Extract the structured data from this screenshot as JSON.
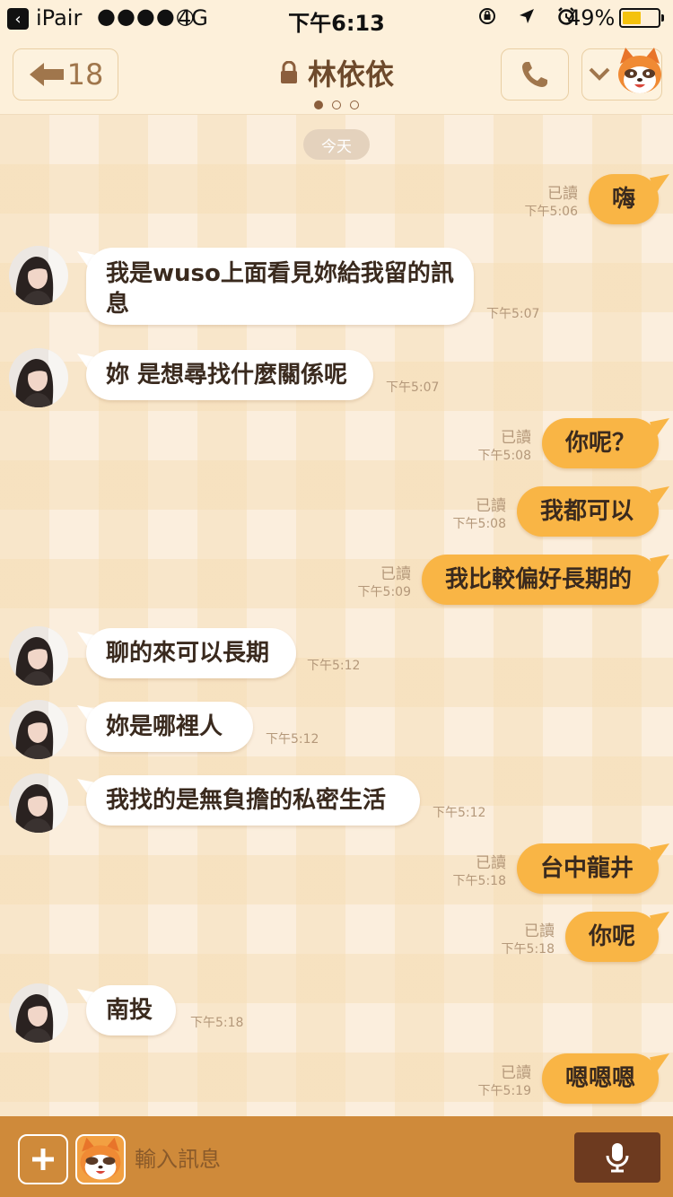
{
  "status_bar": {
    "carrier": "iPair",
    "signal_dots": "●●●●○",
    "network": "4G",
    "time": "下午6:13",
    "battery": "49%",
    "battery_level": 0.49
  },
  "header": {
    "back_count": "18",
    "contact_name": "林依依",
    "page_count": 3,
    "current_page": 1
  },
  "chat": {
    "date_label": "今天",
    "messages": [
      {
        "dir": "out",
        "text": "嗨",
        "read": "已讀",
        "time": "下午5:06"
      },
      {
        "dir": "in",
        "text": "我是wuso上面看見妳給我留的訊息",
        "time": "下午5:07"
      },
      {
        "dir": "in",
        "text": "妳 是想尋找什麼關係呢",
        "time": "下午5:07"
      },
      {
        "dir": "out",
        "text": "你呢？",
        "read": "已讀",
        "time": "下午5:08"
      },
      {
        "dir": "out",
        "text": "我都可以",
        "read": "已讀",
        "time": "下午5:08"
      },
      {
        "dir": "out",
        "text": "我比較偏好長期的",
        "read": "已讀",
        "time": "下午5:09"
      },
      {
        "dir": "in",
        "text": "聊的來可以長期",
        "time": "下午5:12"
      },
      {
        "dir": "in",
        "text": "妳是哪裡人",
        "time": "下午5:12"
      },
      {
        "dir": "in",
        "text": "我找的是無負擔的私密生活",
        "time": "下午5:12"
      },
      {
        "dir": "out",
        "text": "台中龍井",
        "read": "已讀",
        "time": "下午5:18"
      },
      {
        "dir": "out",
        "text": "你呢",
        "read": "已讀",
        "time": "下午5:18"
      },
      {
        "dir": "in",
        "text": "南投",
        "time": "下午5:18"
      },
      {
        "dir": "out",
        "text": "嗯嗯嗯",
        "read": "已讀",
        "time": "下午5:19"
      }
    ]
  },
  "input_bar": {
    "placeholder": "輸入訊息"
  },
  "colors": {
    "outgoing_bubble": "#f9b545",
    "incoming_bubble": "#ffffff",
    "input_bar": "#cf8a3a",
    "mic_button": "#6d3a1f",
    "header_text": "#6e4a2c"
  }
}
